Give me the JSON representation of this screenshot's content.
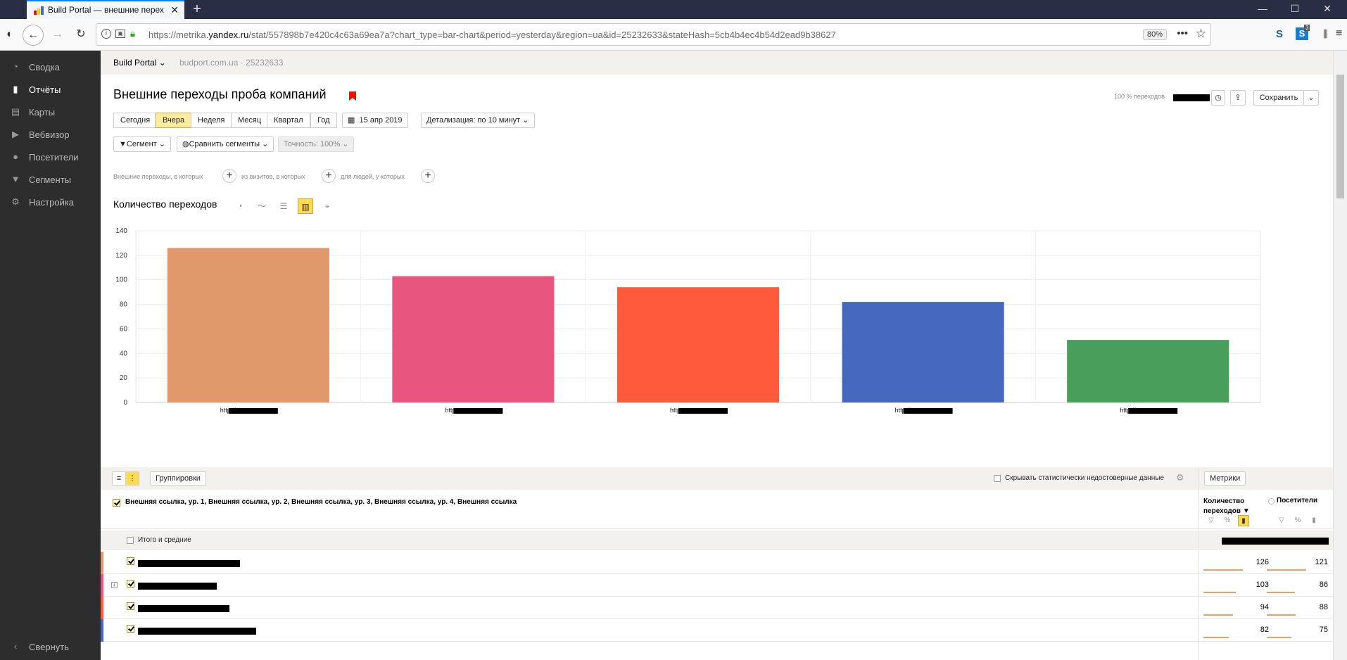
{
  "browser": {
    "tab_title": "Build Portal — внешние переходы",
    "url_prefix": "https://metrika.",
    "url_domain": "yandex.ru",
    "url_rest": "/stat/557898b7e420c4c63a69ea7a?chart_type=bar-chart&period=yesterday&region=ua&id=25232633&stateHash=5cb4b4ec4b54d2ead9b38627",
    "zoom": "80%",
    "badge_count": "3"
  },
  "sidebar": {
    "items": [
      {
        "label": "Сводка",
        "icon": "gauge-icon"
      },
      {
        "label": "Отчёты",
        "icon": "bar-chart-icon"
      },
      {
        "label": "Карты",
        "icon": "map-icon"
      },
      {
        "label": "Вебвизор",
        "icon": "play-icon"
      },
      {
        "label": "Посетители",
        "icon": "person-icon"
      },
      {
        "label": "Сегменты",
        "icon": "funnel-icon"
      },
      {
        "label": "Настройка",
        "icon": "gear-icon"
      }
    ],
    "collapse_label": "Свернуть"
  },
  "breadcrumbs": {
    "counter_name": "Build Portal",
    "domain": "budport.com.ua",
    "counter_id": "25232633"
  },
  "report": {
    "title": "Внешние переходы проба компаний",
    "share_label": "100 % переходов",
    "save_label": "Сохранить"
  },
  "periods": [
    "Сегодня",
    "Вчера",
    "Неделя",
    "Месяц",
    "Квартал",
    "Год"
  ],
  "selected_period": "Вчера",
  "date_label": "15 апр 2019",
  "detail_label": "Детализация: по 10 минут",
  "segment_label": "Сегмент",
  "compare_label": "Сравнить сегменты",
  "accuracy_label": "Точность: 100%",
  "filter_texts": [
    "Внешние переходы, в которых",
    "из визитов, в которых",
    "для людей, у которых"
  ],
  "chart_title": "Количество переходов",
  "chart_data": {
    "type": "bar",
    "categories": [
      "http://",
      "http:/",
      "http:",
      "http://",
      "http://"
    ],
    "values": [
      126,
      103,
      94,
      82,
      51
    ],
    "colors": [
      "#e0996a",
      "#e8567f",
      "#ff5a3c",
      "#4668bf",
      "#4a9e5c"
    ],
    "ylim": [
      0,
      140
    ],
    "yticks": [
      0,
      20,
      40,
      60,
      80,
      100,
      120,
      140
    ],
    "grid": true
  },
  "table": {
    "groupings_label": "Группировки",
    "hide_unreliable_label": "Скрывать статистически недостоверные данные",
    "metrics_label": "Метрики",
    "dimensions_label": "Внешняя ссылка, ур. 1, Внешняя ссылка, ур. 2, Внешняя ссылка, ур. 3, Внешняя ссылка, ур. 4, Внешняя ссылка",
    "metric1_label": "Количество переходов",
    "metric1_sort": "▼",
    "metric2_label": "Посетители",
    "totals_label": "Итого и средние",
    "rows": [
      {
        "transitions": "126",
        "visitors": "121",
        "color": "#e0996a"
      },
      {
        "transitions": "103",
        "visitors": "86",
        "color": "#e8567f"
      },
      {
        "transitions": "94",
        "visitors": "88",
        "color": "#ff5a3c"
      },
      {
        "transitions": "82",
        "visitors": "75",
        "color": "#4668bf"
      }
    ]
  }
}
